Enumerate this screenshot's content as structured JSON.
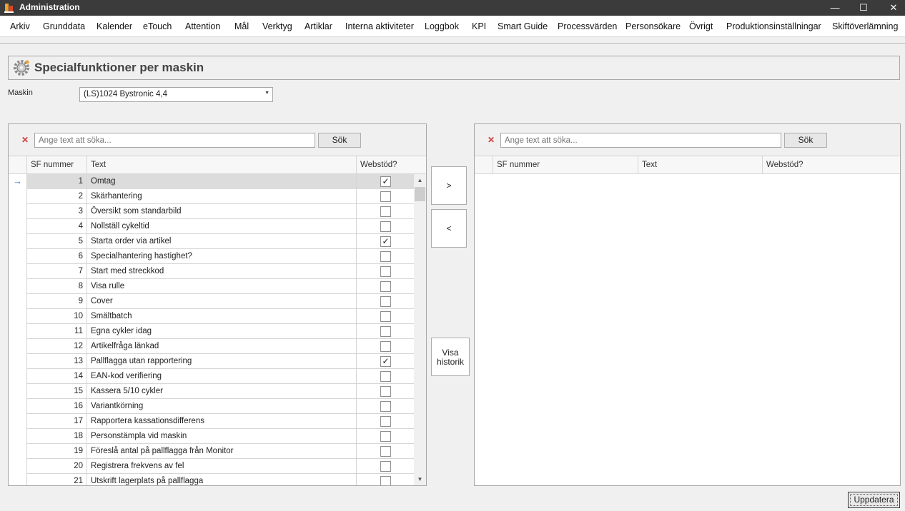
{
  "window": {
    "title": "Administration",
    "minimize": "—",
    "maximize": "☐",
    "close": "✕"
  },
  "menu": [
    "Arkiv",
    "Grunddata",
    "Kalender",
    "eTouch",
    "Attention",
    "Mål",
    "Verktyg",
    "Artiklar",
    "Interna aktiviteter",
    "Loggbok",
    "KPI",
    "Smart Guide",
    "Processvärden",
    "Personsökare",
    "Övrigt",
    "Produktionsinställningar",
    "Skiftöverlämning"
  ],
  "page": {
    "title": "Specialfunktioner per maskin"
  },
  "machine": {
    "label": "Maskin",
    "value": "(LS)1024 Bystronic 4,4"
  },
  "left_panel": {
    "clear_icon": "✕",
    "search_placeholder": "Ange text att söka...",
    "search_button": "Sök",
    "columns": [
      "SF nummer",
      "Text",
      "Webstöd?"
    ],
    "selected_index": 0,
    "rows": [
      {
        "num": "1",
        "text": "Omtag",
        "web": true
      },
      {
        "num": "2",
        "text": "Skärhantering",
        "web": false
      },
      {
        "num": "3",
        "text": "Översikt som standarbild",
        "web": false
      },
      {
        "num": "4",
        "text": "Nollställ cykeltid",
        "web": false
      },
      {
        "num": "5",
        "text": "Starta order via artikel",
        "web": true
      },
      {
        "num": "6",
        "text": "Specialhantering hastighet?",
        "web": false
      },
      {
        "num": "7",
        "text": "Start med streckkod",
        "web": false
      },
      {
        "num": "8",
        "text": "Visa rulle",
        "web": false
      },
      {
        "num": "9",
        "text": "Cover",
        "web": false
      },
      {
        "num": "10",
        "text": "Smältbatch",
        "web": false
      },
      {
        "num": "11",
        "text": "Egna cykler idag",
        "web": false
      },
      {
        "num": "12",
        "text": "Artikelfråga länkad",
        "web": false
      },
      {
        "num": "13",
        "text": "Pallflagga utan rapportering",
        "web": true
      },
      {
        "num": "14",
        "text": "EAN-kod verifiering",
        "web": false
      },
      {
        "num": "15",
        "text": "Kassera 5/10 cykler",
        "web": false
      },
      {
        "num": "16",
        "text": "Variantkörning",
        "web": false
      },
      {
        "num": "17",
        "text": "Rapportera kassationsdifferens",
        "web": false
      },
      {
        "num": "18",
        "text": "Personstämpla vid maskin",
        "web": false
      },
      {
        "num": "19",
        "text": "Föreslå antal på pallflagga från Monitor",
        "web": false
      },
      {
        "num": "20",
        "text": "Registrera frekvens av fel",
        "web": false
      },
      {
        "num": "21",
        "text": "Utskrift lagerplats på pallflagga",
        "web": false
      }
    ]
  },
  "right_panel": {
    "clear_icon": "✕",
    "search_placeholder": "Ange text att söka...",
    "search_button": "Sök",
    "columns": [
      "SF nummer",
      "Text",
      "Webstöd?"
    ]
  },
  "buttons": {
    "move_right": ">",
    "move_left": "<",
    "history_line1": "Visa",
    "history_line2": "historik",
    "update": "Uppdatera"
  },
  "icons": {
    "row_indicator": "→",
    "check": "✓",
    "scroll_up": "▲",
    "scroll_down": "▼",
    "combo_arrow": "▼"
  }
}
